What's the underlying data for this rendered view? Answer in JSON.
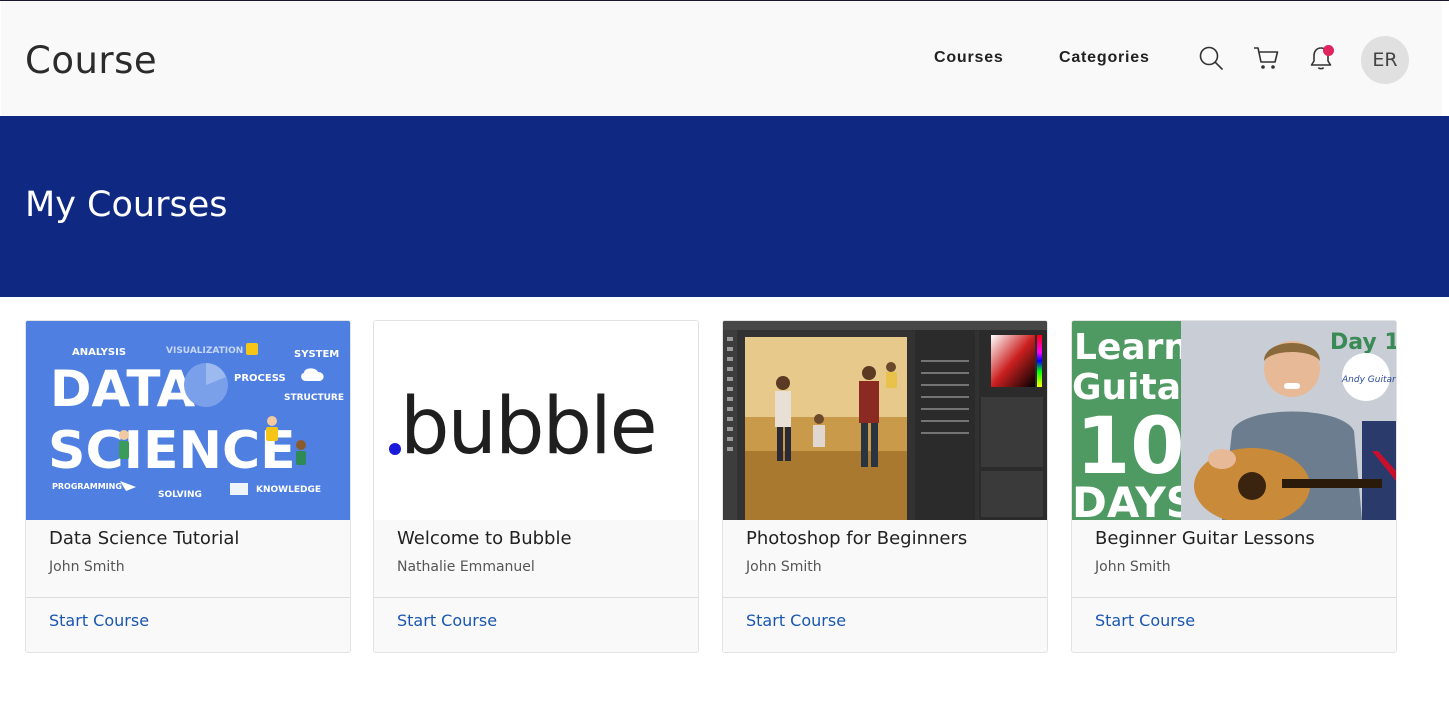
{
  "header": {
    "brand": "Course",
    "nav": [
      "Courses",
      "Categories"
    ],
    "icons": [
      "search-icon",
      "cart-icon",
      "bell-icon"
    ],
    "notification_dot": true,
    "avatar_initials": "ER"
  },
  "banner": {
    "title": "My Courses",
    "color": "#0f2982"
  },
  "courses": [
    {
      "title": "Data Science Tutorial",
      "author": "John Smith",
      "action": "Start Course",
      "thumbnail": {
        "line1": "DATA",
        "line2": "SCIENCE",
        "tags": [
          "ANALYSIS",
          "VISUALIZATION",
          "SYSTEM",
          "PROCESS",
          "STRUCTURE",
          "PROGRAMMING",
          "SOLVING",
          "KNOWLEDGE"
        ]
      }
    },
    {
      "title": "Welcome to Bubble",
      "author": "Nathalie Emmanuel",
      "action": "Start Course",
      "thumbnail": {
        "logo": "bubble"
      }
    },
    {
      "title": "Photoshop for Beginners",
      "author": "John Smith",
      "action": "Start Course",
      "thumbnail": {}
    },
    {
      "title": "Beginner Guitar Lessons",
      "author": "John Smith",
      "action": "Start Course",
      "thumbnail": {
        "lines": [
          "Learn",
          "Guitar",
          "10",
          "DAYS"
        ],
        "badge": "Day 1",
        "brand": "Andy Guitar"
      }
    }
  ],
  "colors": {
    "accent": "#1a56b0",
    "banner": "#0f2982",
    "notification": "#e0245e"
  }
}
